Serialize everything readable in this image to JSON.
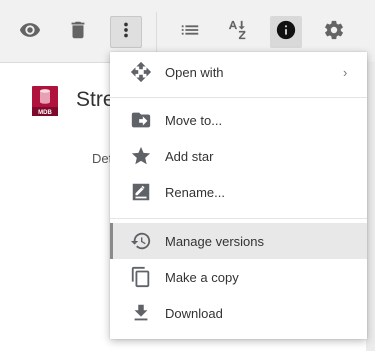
{
  "toolbar": {
    "preview_icon": "eye-icon",
    "delete_icon": "trash-icon",
    "more_icon": "more-vert-icon",
    "list_icon": "list-icon",
    "sort_icon": "sort-az-icon",
    "info_icon": "info-icon",
    "settings_icon": "gear-icon"
  },
  "file": {
    "name": "Stre",
    "type_badge": "MDB",
    "details_label": "Det"
  },
  "menu": {
    "items": [
      {
        "label": "Open with",
        "icon": "open-with-icon",
        "submenu": "›"
      },
      {
        "label": "Move to...",
        "icon": "move-to-folder-icon"
      },
      {
        "label": "Add star",
        "icon": "star-icon"
      },
      {
        "label": "Rename...",
        "icon": "rename-icon"
      },
      {
        "label": "Manage versions",
        "icon": "history-icon"
      },
      {
        "label": "Make a copy",
        "icon": "copy-icon"
      },
      {
        "label": "Download",
        "icon": "download-icon"
      }
    ]
  },
  "colors": {
    "toolbar_bg": "#f1f1f1",
    "icon": "#646464",
    "file_badge": "#b0123e",
    "highlight": "#e8e8e8"
  }
}
